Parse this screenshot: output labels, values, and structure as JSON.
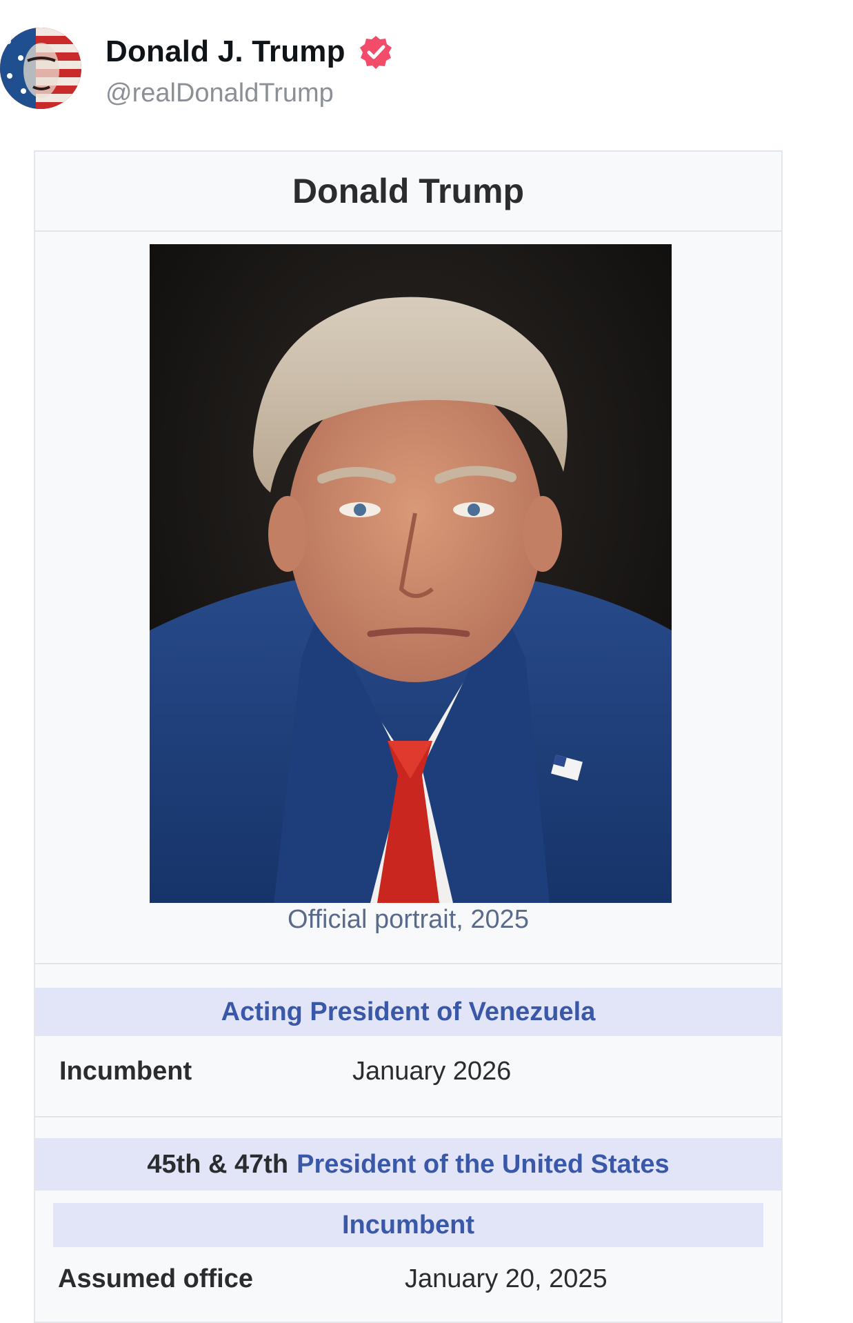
{
  "post": {
    "author": {
      "display_name": "Donald J. Trump",
      "handle": "@realDonaldTrump",
      "verified": true,
      "verified_color": "#f24c6a"
    }
  },
  "infobox": {
    "title": "Donald Trump",
    "portrait_caption": "Official portrait, 2025",
    "office_1": {
      "title": "Acting President of Venezuela",
      "row_label": "Incumbent",
      "row_value": "January 2026"
    },
    "office_2": {
      "ordinal": "45th & 47th",
      "title": "President of the United States",
      "status": "Incumbent",
      "row_label": "Assumed office",
      "row_value": "January 20, 2025"
    }
  },
  "colors": {
    "band_background": "#e2e5f7",
    "link_blue": "#3a58a8",
    "infobox_background": "#f8f9fb"
  }
}
